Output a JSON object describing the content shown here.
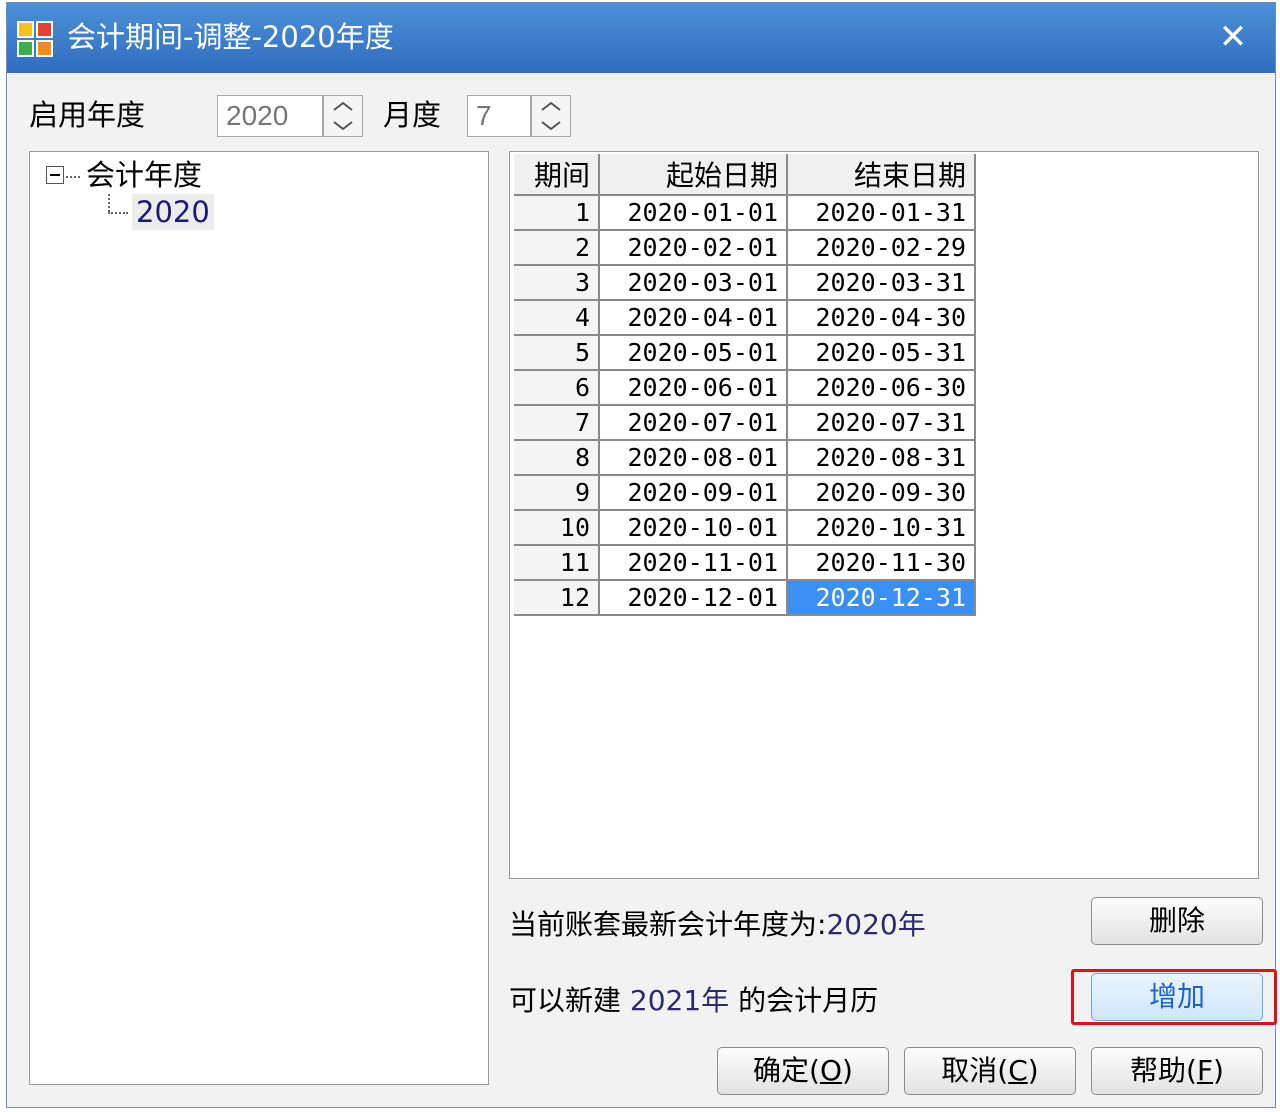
{
  "window": {
    "title": "会计期间-调整-2020年度",
    "close_glyph": "✕"
  },
  "fields": {
    "year_label": "启用年度",
    "year_value": "2020",
    "month_label": "月度",
    "month_value": "7"
  },
  "tree": {
    "root_label": "会计年度",
    "child_label": "2020"
  },
  "table": {
    "headers": [
      "期间",
      "起始日期",
      "结束日期"
    ],
    "rows": [
      [
        "1",
        "2020-01-01",
        "2020-01-31"
      ],
      [
        "2",
        "2020-02-01",
        "2020-02-29"
      ],
      [
        "3",
        "2020-03-01",
        "2020-03-31"
      ],
      [
        "4",
        "2020-04-01",
        "2020-04-30"
      ],
      [
        "5",
        "2020-05-01",
        "2020-05-31"
      ],
      [
        "6",
        "2020-06-01",
        "2020-06-30"
      ],
      [
        "7",
        "2020-07-01",
        "2020-07-31"
      ],
      [
        "8",
        "2020-08-01",
        "2020-08-31"
      ],
      [
        "9",
        "2020-09-01",
        "2020-09-30"
      ],
      [
        "10",
        "2020-10-01",
        "2020-10-31"
      ],
      [
        "11",
        "2020-11-01",
        "2020-11-30"
      ],
      [
        "12",
        "2020-12-01",
        "2020-12-31"
      ]
    ],
    "selected_row": 11,
    "selected_col": 2
  },
  "info": {
    "latest_prefix": "当前账套最新会计年度为:",
    "latest_year": "2020年",
    "new_prefix": "可以新建",
    "new_year": "2021年",
    "new_suffix": "的会计月历"
  },
  "buttons": {
    "delete": "删除",
    "add": "增加",
    "ok": "确定(",
    "ok_key": "O",
    "cancel": "取消(",
    "cancel_key": "C",
    "help": "帮助(",
    "help_key": "F",
    "close_paren": ")"
  },
  "colors": {
    "title_bar": "#3a7dcc",
    "selection": "#3b8ff2",
    "highlight": "#e0101a"
  }
}
